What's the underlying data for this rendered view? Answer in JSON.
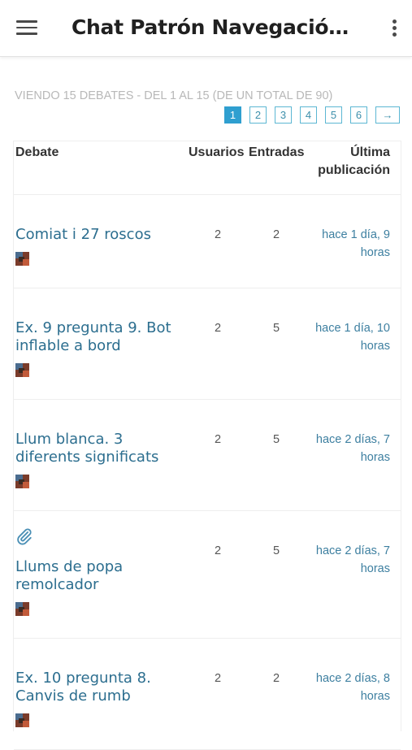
{
  "app": {
    "title": "Chat Patrón Navegación..."
  },
  "list": {
    "count_text": "VIENDO 15 DEBATES - DEL 1 AL 15 (DE UN TOTAL DE 90)",
    "pages": [
      "1",
      "2",
      "3",
      "4",
      "5",
      "6"
    ],
    "current_page": "1",
    "next_label": "→"
  },
  "table": {
    "headers": {
      "debate": "Debate",
      "users": "Usuarios",
      "posts": "Entradas",
      "last_line1": "Última",
      "last_line2": "publicación"
    },
    "rows": [
      {
        "title": "Comiat i 27 roscos",
        "users": "2",
        "posts": "2",
        "last_line1": "hace 1 día, 9",
        "last_line2": "horas",
        "attachment": false
      },
      {
        "title": "Ex. 9 pregunta 9. Bot inflable a bord",
        "users": "2",
        "posts": "5",
        "last_line1": "hace 1 día, 10",
        "last_line2": "horas",
        "attachment": false
      },
      {
        "title": "Llum blanca. 3 diferents significats",
        "users": "2",
        "posts": "5",
        "last_line1": "hace 2 días, 7",
        "last_line2": "horas",
        "attachment": false
      },
      {
        "title": "Llums de popa remolcador",
        "users": "2",
        "posts": "5",
        "last_line1": "hace 2 días, 7",
        "last_line2": "horas",
        "attachment": true
      },
      {
        "title": "Ex. 10 pregunta 8. Canvis de rumb",
        "users": "2",
        "posts": "2",
        "last_line1": "hace 2 días, 8",
        "last_line2": "horas",
        "attachment": false
      }
    ]
  },
  "icons": {
    "menu": "hamburger-menu-icon",
    "more": "more-vert-icon",
    "attachment": "paperclip-icon"
  },
  "colors": {
    "link": "#2c6e8f",
    "accent": "#2f9fd0",
    "muted": "#b8b8b8"
  }
}
